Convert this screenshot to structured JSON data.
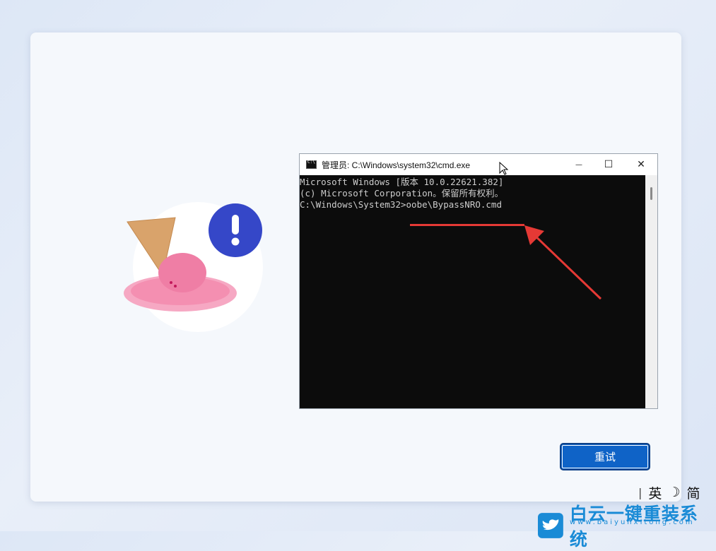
{
  "cmd_window": {
    "title": "管理员: C:\\Windows\\system32\\cmd.exe",
    "lines": [
      "Microsoft Windows [版本 10.0.22621.382]",
      "(c) Microsoft Corporation。保留所有权利。",
      "",
      "C:\\Windows\\System32>oobe\\BypassNRO.cmd"
    ],
    "controls": {
      "minimize": "—",
      "maximize": "☐",
      "close": "✕"
    }
  },
  "retry_button": {
    "label": "重试"
  },
  "tray": {
    "lang": "英",
    "moon": "☽",
    "ime_mode": "简"
  },
  "watermark": {
    "text": "白云一键重装系统",
    "url": "www.baiyunxitong.com"
  },
  "colors": {
    "accent": "#0f63c7",
    "annotation": "#e53935",
    "console_bg": "#0c0c0c"
  }
}
